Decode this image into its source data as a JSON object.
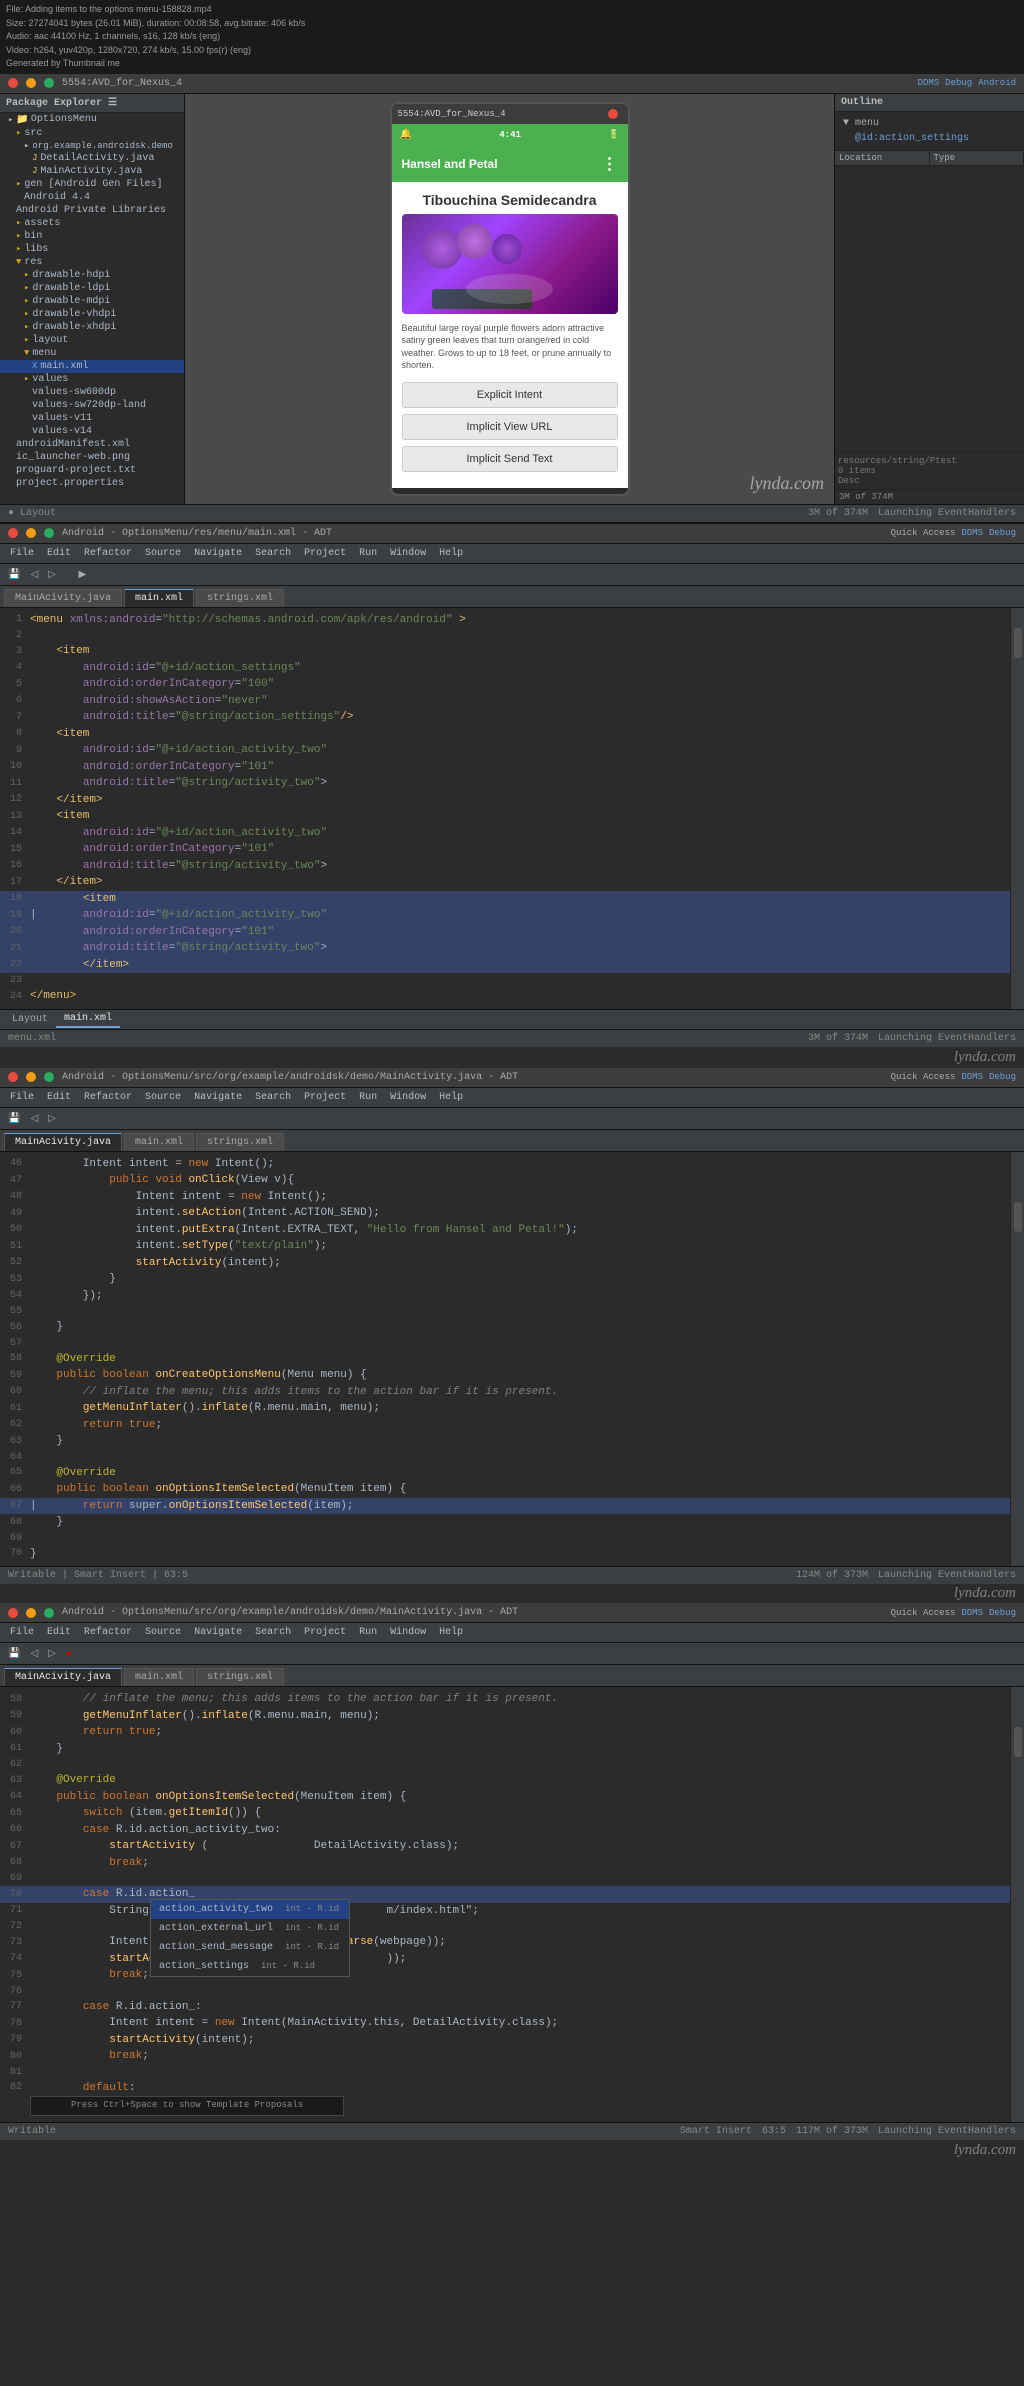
{
  "meta": {
    "video_title": "File: Adding items to the options menu-158828.mp4",
    "video_info": "Size: 27274041 bytes (26.01 MiB), duration: 00:08:58, avg.bitrate: 406 kb/s",
    "audio_info": "Audio: aac 44100 Hz, 1 channels, s16, 128 kb/s (eng)",
    "video_info2": "Video: h264, yuv420p, 1280x720, 274 kb/s, 15.00 fps(r) (eng)",
    "generated_by": "Generated by Thumbnail me"
  },
  "emulator": {
    "title": "5554:AVD_for_Nexus_4",
    "time": "4:41",
    "app_name": "Hansel and Petal",
    "plant_name": "Tibouchina Semidecandra",
    "plant_description": "Beautiful large royal purple flowers adorn attractive satiny green leaves that turn orange/red in cold weather. Grows to up to 18 feet, or prune annually to shorten.",
    "buttons": {
      "explicit_intent": "Explicit Intent",
      "implicit_view_url": "Implicit View URL",
      "implicit_send_text": "Implicit Send Text"
    }
  },
  "section1": {
    "title": "Android - OptionsMenu/res/menu/main.xml - ADT",
    "tabs": [
      "MainAcivity.java",
      "main.xml",
      "strings.xml"
    ],
    "active_tab": "main.xml",
    "bottom_tabs": [
      "Layout",
      "main.xml"
    ],
    "active_bottom_tab": "main.xml",
    "status": "3M of 374M",
    "status_right": "Launching EventHandlers"
  },
  "section2": {
    "title": "Android - OptionsMenu/src/org/example/androidsk/demo/MainActivity.java - ADT",
    "tabs": [
      "MainAcivity.java",
      "main.xml",
      "strings.xml"
    ],
    "active_tab": "MainAcivity.java",
    "status": "124M of 373M",
    "status_right": "Launching EventHandlers",
    "status_info": "Writable | Smart Insert | 63:5"
  },
  "section3": {
    "title": "Android - OptionsMenu/src/org/example/androidsk/demo/MainActivity.java - ADT",
    "tabs": [
      "MainAcivity.java",
      "main.xml",
      "strings.xml"
    ],
    "active_tab": "MainAcivity.java",
    "status": "117M of 373M",
    "status_right": "Launching EventHandlers",
    "status_info": "Writable | Smart Insert | 63:5"
  },
  "xml_code": [
    {
      "num": 1,
      "content": "<menu xmlns:android=\"http://schemas.android.com/apk/res/android\" >"
    },
    {
      "num": 2,
      "content": ""
    },
    {
      "num": 3,
      "content": "    <item"
    },
    {
      "num": 4,
      "content": "        android:id=\"@+id/action_settings\""
    },
    {
      "num": 5,
      "content": "        android:orderInCategory=\"100\""
    },
    {
      "num": 6,
      "content": "        android:showAsAction=\"never\""
    },
    {
      "num": 7,
      "content": "        android:title=\"@string/action_settings\"/>"
    },
    {
      "num": 8,
      "content": "    <item"
    },
    {
      "num": 9,
      "content": "        android:id=\"@+id/action_activity_two\""
    },
    {
      "num": 10,
      "content": "        android:orderInCategory=\"101\""
    },
    {
      "num": 11,
      "content": "        android:title=\"@string/activity_two\">"
    },
    {
      "num": 12,
      "content": "    </item>"
    },
    {
      "num": 13,
      "content": "    <item"
    },
    {
      "num": 14,
      "content": "        android:id=\"@+id/action_activity_two\""
    },
    {
      "num": 15,
      "content": "        android:orderInCategory=\"101\""
    },
    {
      "num": 16,
      "content": "        android:title=\"@string/activity_two\">"
    },
    {
      "num": 17,
      "content": "    </item>"
    },
    {
      "num": 18,
      "content": "        <item"
    },
    {
      "num": 19,
      "content": "        android:id=\"@+id/action_activity_two\""
    },
    {
      "num": 20,
      "content": "        android:orderInCategory=\"101\""
    },
    {
      "num": 21,
      "content": "        android:title=\"@string/activity_two\">"
    },
    {
      "num": 22,
      "content": "        </item>"
    },
    {
      "num": 23,
      "content": ""
    },
    {
      "num": 24,
      "content": "</menu>"
    }
  ],
  "java_code_section2": [
    {
      "num": 46,
      "content": "        Intent intent = new Intent();"
    },
    {
      "num": 47,
      "content": "        public void onClick(View v){"
    },
    {
      "num": 48,
      "content": "            Intent intent = new Intent();"
    },
    {
      "num": 49,
      "content": "            intent.setAction(Intent.ACTION_SEND);"
    },
    {
      "num": 50,
      "content": "            intent.putExtra(Intent.EXTRA_TEXT, \"Hello from Hansel and Petal!\");"
    },
    {
      "num": 51,
      "content": "            intent.setType(\"text/plain\");"
    },
    {
      "num": 52,
      "content": "            startActivity(intent);"
    },
    {
      "num": 53,
      "content": "        }"
    },
    {
      "num": 54,
      "content": "    });"
    },
    {
      "num": 55,
      "content": ""
    },
    {
      "num": 56,
      "content": "}"
    },
    {
      "num": 57,
      "content": ""
    },
    {
      "num": 58,
      "content": "@Override"
    },
    {
      "num": 59,
      "content": "public boolean onCreateOptionsMenu(Menu menu) {"
    },
    {
      "num": 60,
      "content": "    // inflate the menu; this adds items to the action bar if it is present."
    },
    {
      "num": 61,
      "content": "    getMenuInflater().inflate(R.menu.main, menu);"
    },
    {
      "num": 62,
      "content": "    return true;"
    },
    {
      "num": 63,
      "content": "}"
    },
    {
      "num": 64,
      "content": ""
    },
    {
      "num": 65,
      "content": "@Override"
    },
    {
      "num": 66,
      "content": "public boolean onOptionsItemSelected(MenuItem item) {"
    },
    {
      "num": 67,
      "content": "    return super.onOptionsItemSelected(item);"
    },
    {
      "num": 68,
      "content": "}"
    },
    {
      "num": 69,
      "content": ""
    },
    {
      "num": 70,
      "content": "}"
    }
  ],
  "java_code_section3": [
    {
      "num": 58,
      "content": "    // inflate the menu; this adds items to the action bar if it is present."
    },
    {
      "num": 59,
      "content": "    getMenuInflater().inflate(R.menu.main, menu);"
    },
    {
      "num": 60,
      "content": "    return true;"
    },
    {
      "num": 61,
      "content": "}"
    },
    {
      "num": 62,
      "content": ""
    },
    {
      "num": 63,
      "content": "@Override"
    },
    {
      "num": 64,
      "content": "public boolean onOptionsItemSelected(MenuItem item) {"
    },
    {
      "num": 65,
      "content": "    switch (item.getItemId()) {"
    },
    {
      "num": 66,
      "content": "    case R.id.action_activity_two:"
    },
    {
      "num": 67,
      "content": "        startActivity (                DetailActivity.class);"
    },
    {
      "num": 68,
      "content": "        break;"
    },
    {
      "num": 69,
      "content": ""
    },
    {
      "num": 70,
      "content": "    case R.id.action_"
    },
    {
      "num": 71,
      "content": "        String webpag                             m/index.html\";"
    },
    {
      "num": 72,
      "content": ""
    },
    {
      "num": 73,
      "content": "        Intent intent                , Uri.parse(webpage));"
    },
    {
      "num": 74,
      "content": "        startActivity                             ));"
    },
    {
      "num": 75,
      "content": "        break;"
    },
    {
      "num": 76,
      "content": ""
    },
    {
      "num": 77,
      "content": "    case R.id.action_:"
    },
    {
      "num": 78,
      "content": "        Intent intent = new Intent(MainActivity.this, DetailActivity.class);"
    },
    {
      "num": 79,
      "content": "        startActivity(intent);"
    },
    {
      "num": 80,
      "content": "        break;"
    },
    {
      "num": 81,
      "content": ""
    },
    {
      "num": 82,
      "content": "    default:"
    }
  ],
  "autocomplete": {
    "items": [
      {
        "label": "action_activity_two",
        "type": "int - R.id"
      },
      {
        "label": "action_external_url",
        "type": "int - R.id"
      },
      {
        "label": "action_send_message",
        "type": "int - R.id"
      },
      {
        "label": "action_settings",
        "type": "int - R.id"
      }
    ],
    "hint": "Press Ctrl+Space to show Template Proposals"
  },
  "package_explorer": {
    "title": "Package Explorer",
    "items": [
      {
        "label": "OptionsMenu",
        "indent": 0,
        "type": "project"
      },
      {
        "label": "src",
        "indent": 1,
        "type": "folder"
      },
      {
        "label": "org.example.androidsk.demo",
        "indent": 2,
        "type": "package"
      },
      {
        "label": "DetailActivity.java",
        "indent": 3,
        "type": "java"
      },
      {
        "label": "MainActivity.java",
        "indent": 3,
        "type": "java"
      },
      {
        "label": "gen [Android Gen Files]",
        "indent": 1,
        "type": "folder"
      },
      {
        "label": "Android 4.4",
        "indent": 2,
        "type": "folder"
      },
      {
        "label": "Android Private Libraries",
        "indent": 1,
        "type": "folder"
      },
      {
        "label": "assets",
        "indent": 1,
        "type": "folder"
      },
      {
        "label": "bin",
        "indent": 1,
        "type": "folder"
      },
      {
        "label": "libs",
        "indent": 1,
        "type": "folder"
      },
      {
        "label": "res",
        "indent": 1,
        "type": "folder"
      },
      {
        "label": "drawable-hdpi",
        "indent": 2,
        "type": "folder"
      },
      {
        "label": "drawable-ldpi",
        "indent": 2,
        "type": "folder"
      },
      {
        "label": "drawable-mdpi",
        "indent": 2,
        "type": "folder"
      },
      {
        "label": "drawable-vhdpi",
        "indent": 2,
        "type": "folder"
      },
      {
        "label": "drawable-xhdpi",
        "indent": 2,
        "type": "folder"
      },
      {
        "label": "layout",
        "indent": 2,
        "type": "folder"
      },
      {
        "label": "menu",
        "indent": 2,
        "type": "folder"
      },
      {
        "label": "main.xml",
        "indent": 3,
        "type": "xml"
      },
      {
        "label": "values",
        "indent": 2,
        "type": "folder"
      },
      {
        "label": "values-sw600dp",
        "indent": 3,
        "type": "folder"
      },
      {
        "label": "values-sw720dp-land",
        "indent": 3,
        "type": "folder"
      },
      {
        "label": "values-v11",
        "indent": 3,
        "type": "folder"
      },
      {
        "label": "values-v14",
        "indent": 3,
        "type": "folder"
      },
      {
        "label": "androidManifest.xml",
        "indent": 1,
        "type": "xml"
      },
      {
        "label": "ic_launcher-web.png",
        "indent": 1,
        "type": "image"
      },
      {
        "label": "proguard-project.txt",
        "indent": 1,
        "type": "file"
      },
      {
        "label": "project.properties",
        "indent": 1,
        "type": "file"
      }
    ]
  },
  "lynda": {
    "watermark": "lynda.com"
  },
  "menubar_items": [
    "File",
    "Edit",
    "Refactor",
    "Source",
    "Navigate",
    "Search",
    "Project",
    "Run",
    "Window",
    "Help"
  ]
}
